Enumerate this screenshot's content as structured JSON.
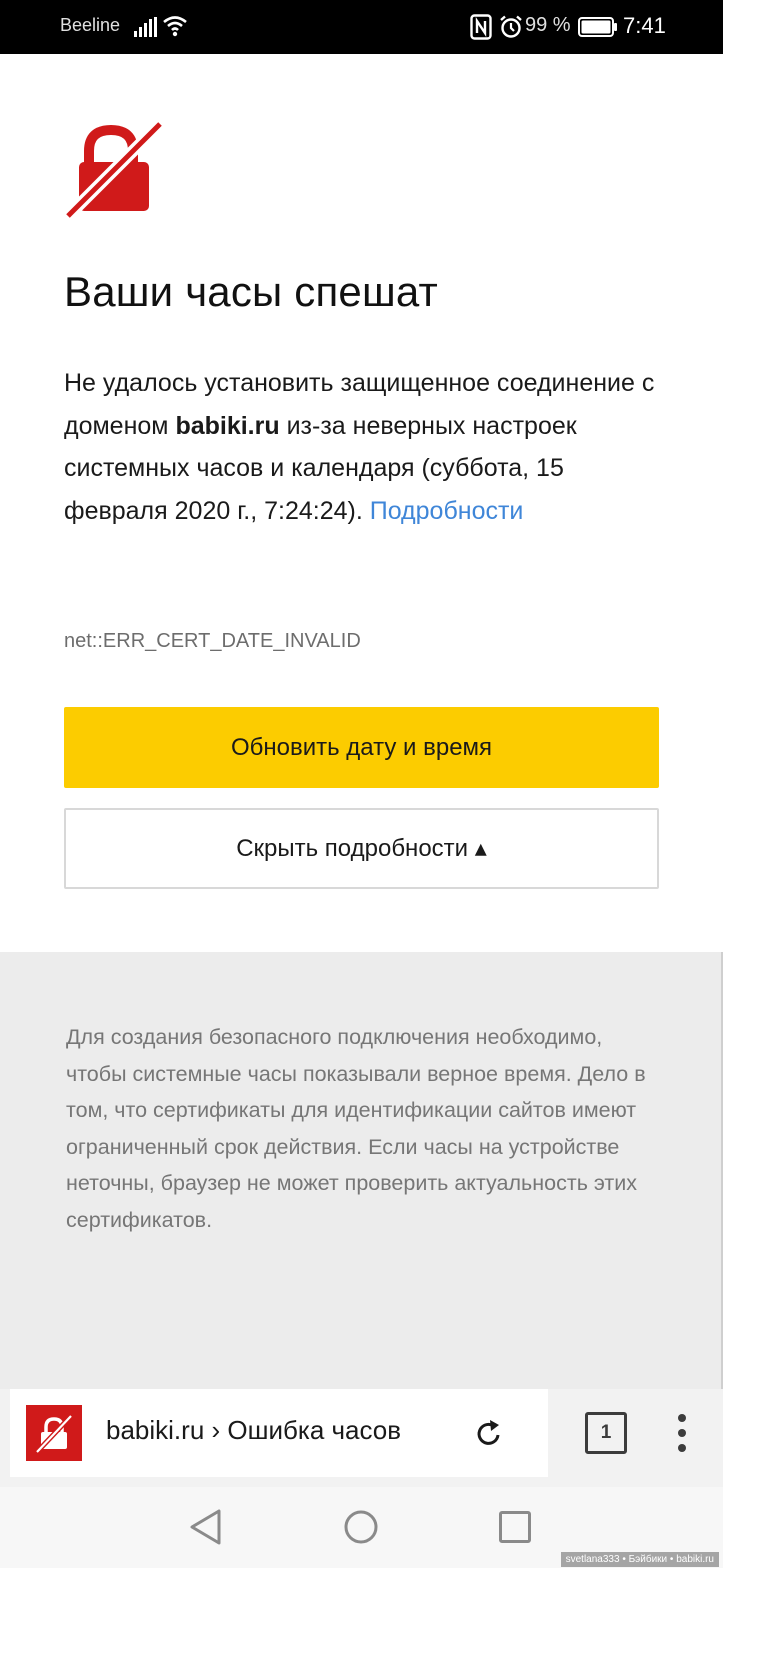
{
  "status_bar": {
    "carrier": "Beeline",
    "battery_percent": "99 %",
    "time": "7:41"
  },
  "page": {
    "title": "Ваши часы спешат",
    "message_part1": "Не удалось установить защищенное соединение с доменом ",
    "domain": "babiki.ru",
    "message_part2": " из-за неверных настроек системных часов и календаря (суббота, 15 февраля 2020 г., 7:24:24). ",
    "details_link": "Подробности",
    "error_code": "net::ERR_CERT_DATE_INVALID",
    "update_button": "Обновить дату и время",
    "hide_details_button": "Скрыть подробности ▴"
  },
  "details_panel": {
    "text": "Для создания безопасного подключения необходимо, чтобы системные часы показывали верное время. Дело в том, что сертификаты для идентификации сайтов имеют ограниченный срок действия. Если часы на устройстве неточны, браузер не может проверить актуальность этих сертификатов."
  },
  "browser_bar": {
    "omnibox_text": "babiki.ru › Ошибка часов",
    "tab_count": "1"
  },
  "watermark": "svetlana333 • Бэйбики • babiki.ru",
  "colors": {
    "accent_yellow": "#fccc00",
    "error_red": "#d01a1a",
    "link_blue": "#3f86d8",
    "panel_gray": "#ececec"
  },
  "icons": [
    "signal-icon",
    "wifi-icon",
    "nfc-icon",
    "alarm-icon",
    "battery-icon",
    "broken-lock-icon",
    "reload-icon",
    "more-vert-icon",
    "back-icon",
    "home-icon",
    "recent-apps-icon"
  ]
}
